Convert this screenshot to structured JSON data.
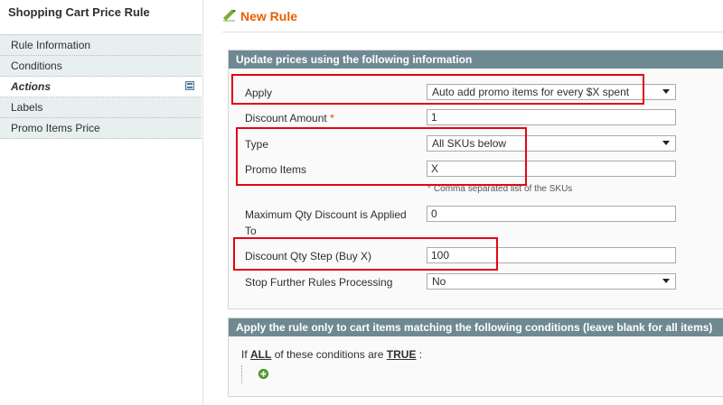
{
  "sidebar": {
    "title": "Shopping Cart Price Rule",
    "tabs": [
      {
        "label": "Rule Information"
      },
      {
        "label": "Conditions"
      },
      {
        "label": "Actions"
      },
      {
        "label": "Labels"
      },
      {
        "label": "Promo Items Price"
      }
    ]
  },
  "header": {
    "title": "New Rule"
  },
  "actions_panel": {
    "heading": "Update prices using the following information",
    "apply": {
      "label": "Apply",
      "value": "Auto add promo items for every $X spent"
    },
    "discount_amount": {
      "label": "Discount Amount",
      "required_mark": "*",
      "value": "1"
    },
    "type": {
      "label": "Type",
      "value": "All SKUs below"
    },
    "promo_items": {
      "label": "Promo Items",
      "value": "X",
      "note": "Comma separated list of the SKUs",
      "note_mark": "*"
    },
    "max_qty": {
      "label_line1": "Maximum Qty Discount is Applied",
      "label_line2": "To",
      "value": "0"
    },
    "discount_qty_step": {
      "label": "Discount Qty Step (Buy X)",
      "value": "100"
    },
    "stop_processing": {
      "label": "Stop Further Rules Processing",
      "value": "No"
    }
  },
  "conditions_panel": {
    "heading": "Apply the rule only to cart items matching the following conditions (leave blank for all items)",
    "prefix": "If",
    "aggregator": "ALL",
    "middle": "of these conditions are",
    "value": "TRUE",
    "suffix": ":"
  },
  "colors": {
    "accent": "#eb5e00",
    "panel_header": "#6f8992",
    "highlight": "#e30613",
    "tab_bg": "#e7efef"
  }
}
